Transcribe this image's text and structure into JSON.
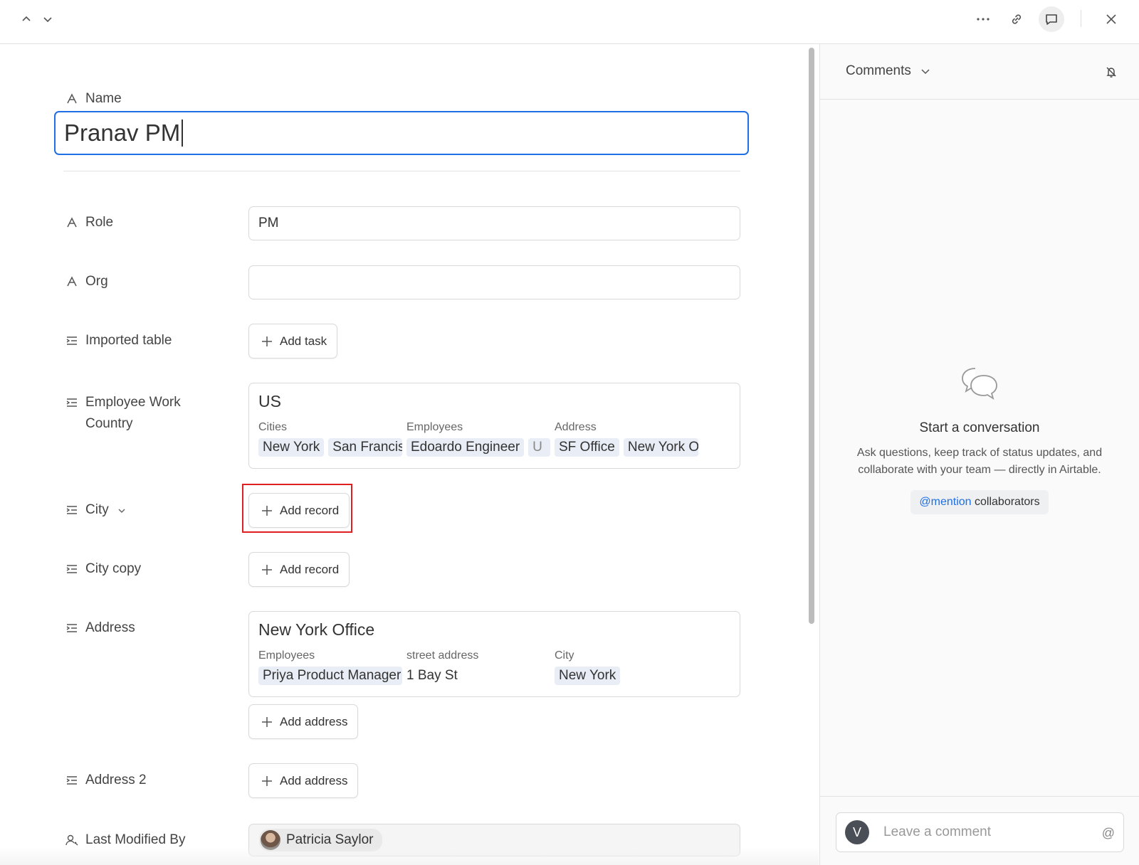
{
  "topbar": {
    "prev_icon": "chevron-up-icon",
    "next_icon": "chevron-down-icon",
    "more_icon": "ellipsis-icon",
    "link_icon": "link-icon",
    "comments_icon": "comment-icon",
    "close_icon": "close-icon"
  },
  "record": {
    "name_label": "Name",
    "name_value": "Pranav PM",
    "fields": {
      "role": {
        "label": "Role",
        "value": "PM"
      },
      "org": {
        "label": "Org",
        "value": ""
      },
      "imported_table": {
        "label": "Imported table",
        "button": "Add task"
      },
      "employee_work_country": {
        "label": "Employee Work Country",
        "card": {
          "title": "US",
          "columns": [
            {
              "label": "Cities",
              "chips": [
                "New York",
                "San Francisco"
              ]
            },
            {
              "label": "Employees",
              "chips": [
                "Edoardo Engineer",
                "U"
              ]
            },
            {
              "label": "Address",
              "chips": [
                "SF Office",
                "New York Office"
              ]
            }
          ]
        }
      },
      "city": {
        "label": "City",
        "button": "Add record"
      },
      "city_copy": {
        "label": "City copy",
        "button": "Add record"
      },
      "address": {
        "label": "Address",
        "card": {
          "title": "New York Office",
          "employees_label": "Employees",
          "employees_chip": "Priya Product Manager",
          "street_label": "street address",
          "street_value": "1 Bay St",
          "city_label": "City",
          "city_chip": "New York"
        },
        "button": "Add address"
      },
      "address_2": {
        "label": "Address 2",
        "button": "Add address"
      },
      "last_modified_by": {
        "label": "Last Modified By",
        "user": "Patricia Saylor"
      }
    }
  },
  "comments": {
    "title": "Comments",
    "empty_title": "Start a conversation",
    "empty_desc": "Ask questions, keep track of status updates, and collaborate with your team — directly in Airtable.",
    "mention_at": "@mention",
    "mention_rest": " collaborators",
    "input_placeholder": "Leave a comment",
    "avatar_initial": "V",
    "at_symbol": "@"
  },
  "colors": {
    "accent": "#1f6fe5",
    "highlight": "#e02020",
    "chip_bg": "#e9edf5"
  }
}
